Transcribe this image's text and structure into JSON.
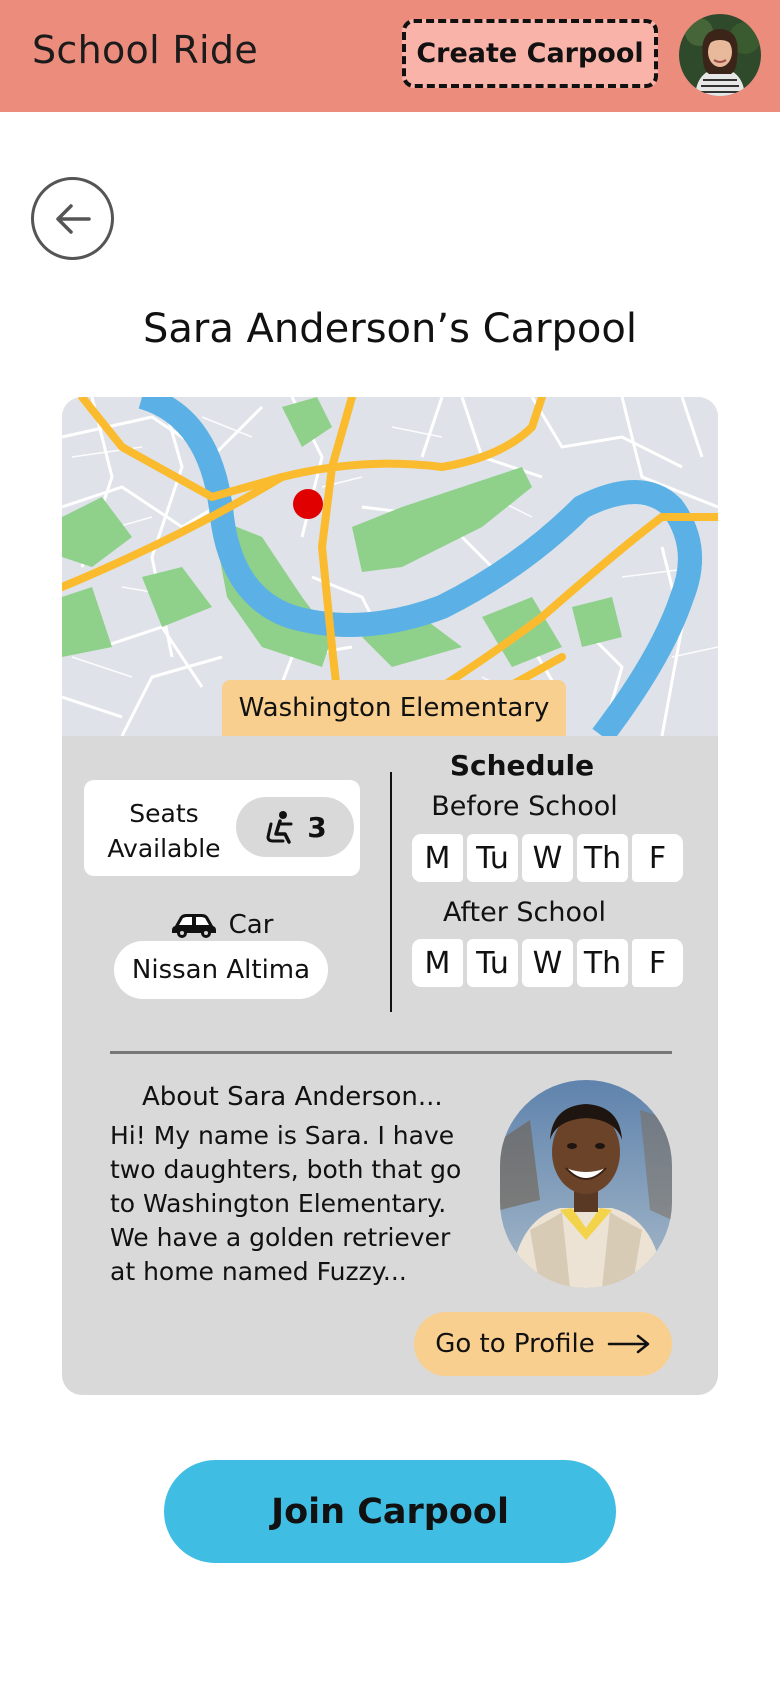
{
  "header": {
    "brand": "School Ride",
    "create_label": "Create Carpool",
    "avatar_icon": "user-avatar"
  },
  "nav": {
    "back_icon": "arrow-left-icon"
  },
  "page": {
    "title": "Sara Anderson’s Carpool"
  },
  "map": {
    "school_name": "Washington Elementary",
    "marker_color": "#e00000"
  },
  "seats": {
    "label": "Seats Available",
    "count": "3",
    "icon": "car-seat-icon"
  },
  "car": {
    "label": "Car",
    "model": "Nissan Altima",
    "icon": "car-icon"
  },
  "schedule": {
    "title": "Schedule",
    "before_label": "Before School",
    "before_days": [
      "M",
      "Tu",
      "W",
      "Th",
      "F"
    ],
    "after_label": "After School",
    "after_days": [
      "M",
      "Tu",
      "W",
      "Th",
      "F"
    ]
  },
  "about": {
    "title": "About Sara Anderson...",
    "text": "Hi! My name is Sara. I have two daughters, both that go to Washington Elementary. We have a golden retriever at home named Fuzzy...",
    "photo_icon": "profile-photo"
  },
  "profile_button": {
    "label": "Go to Profile",
    "icon": "arrow-right-icon"
  },
  "join_button": {
    "label": "Join Carpool"
  },
  "colors": {
    "header": "#ec8c7c",
    "create_button": "#f9b3a8",
    "card": "#d9d9d9",
    "school_tag": "#f9cf8f",
    "join_button": "#3fbde2"
  }
}
